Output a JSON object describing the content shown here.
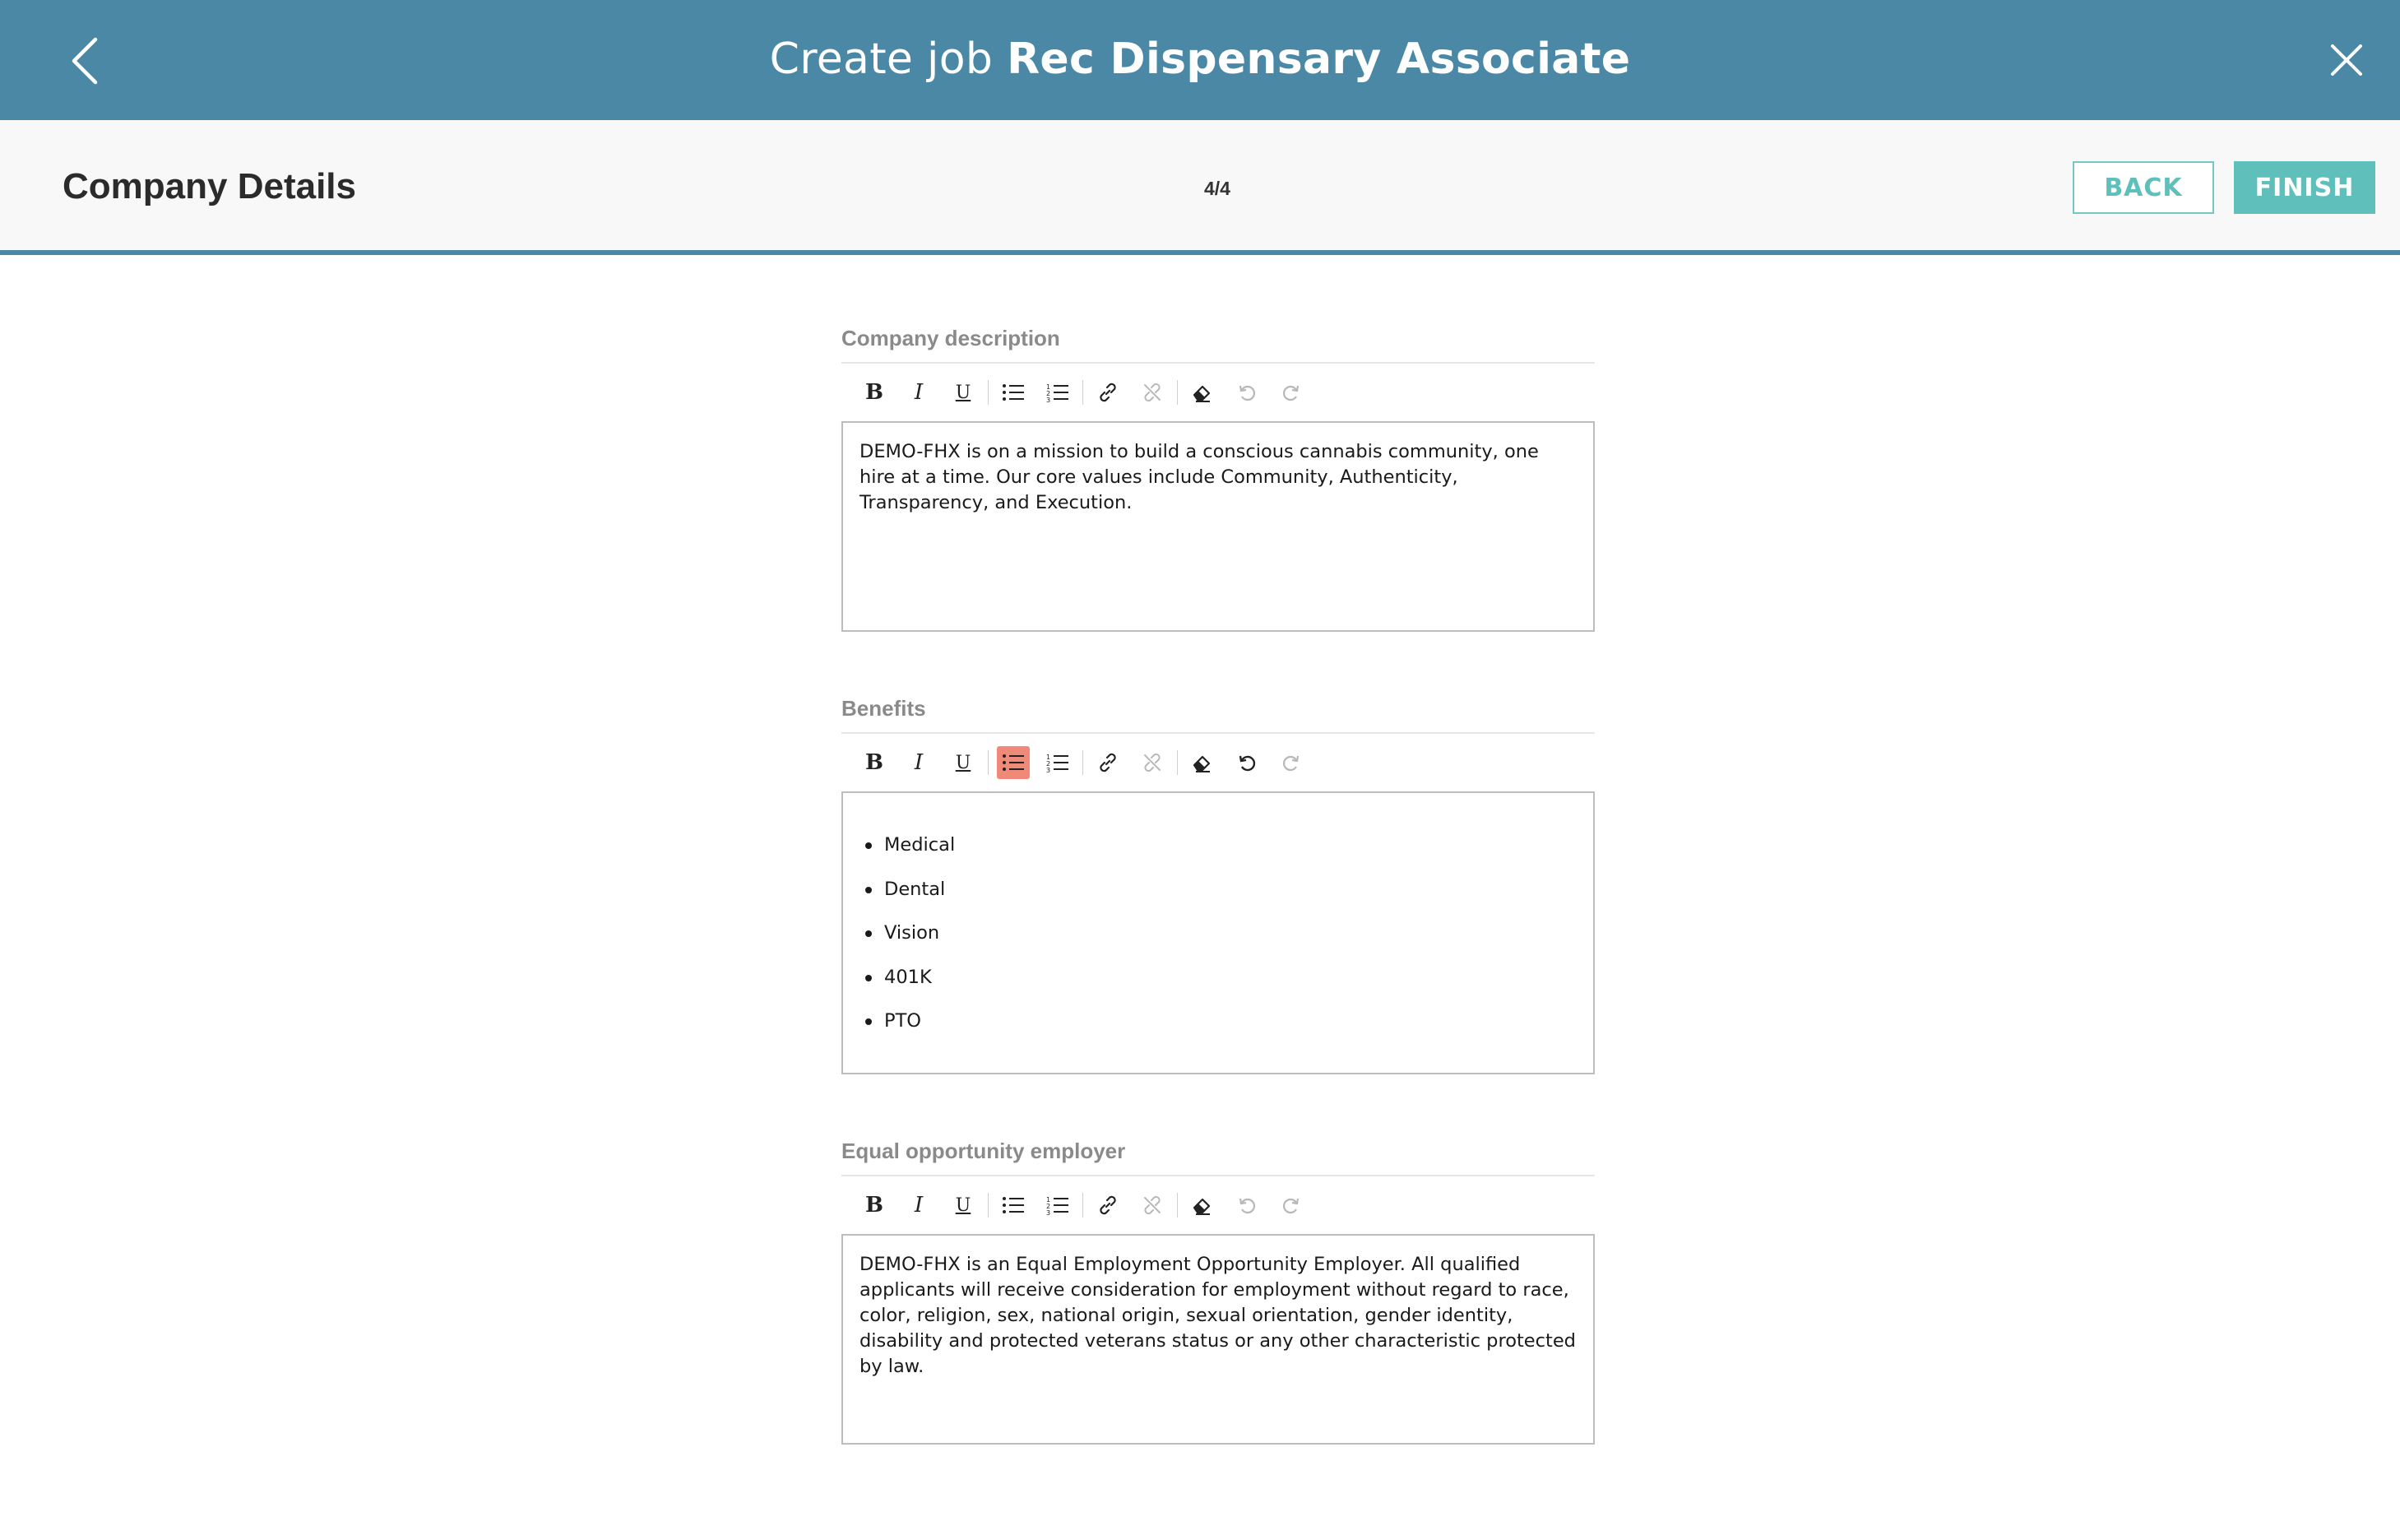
{
  "header": {
    "title_prefix": "Create job",
    "title_job": "Rec Dispensary Associate"
  },
  "subheader": {
    "section_title": "Company Details",
    "step": "4/4",
    "back_label": "BACK",
    "finish_label": "FINISH"
  },
  "fields": {
    "company_description": {
      "label": "Company description",
      "value": "DEMO-FHX is on a mission to build a conscious cannabis community, one hire at a time. Our core values include Community, Authenticity, Transparency, and Execution."
    },
    "benefits": {
      "label": "Benefits",
      "items": [
        "Medical",
        "Dental",
        "Vision",
        "401K",
        "PTO"
      ]
    },
    "equal_opportunity": {
      "label": "Equal opportunity employer",
      "value": "DEMO-FHX is an Equal Employment Opportunity Employer. All qualified applicants will receive consideration for employment without regard to race, color, religion, sex, national origin, sexual orientation, gender identity, disability and protected veterans status or any other characteristic protected by law."
    }
  },
  "toolbar": {
    "bold": "B",
    "italic": "I",
    "underline": "U",
    "active_color": "#f08a78"
  },
  "colors": {
    "header_bg": "#4a88a6",
    "accent": "#5ebfbb"
  }
}
